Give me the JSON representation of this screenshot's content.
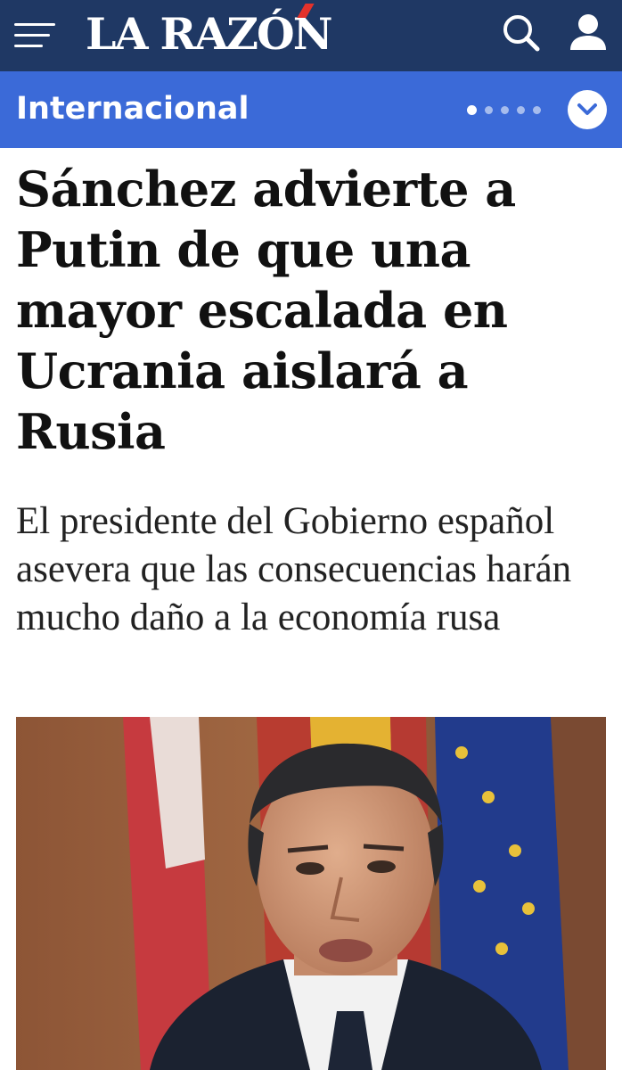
{
  "header": {
    "logo_text": "LA RAZÓN",
    "background_color": "#1f3864",
    "logo_accent_color": "#e3322b",
    "menu_icon": "hamburger-menu-icon",
    "search_icon": "search-icon",
    "user_icon": "user-icon"
  },
  "section_bar": {
    "label": "Internacional",
    "background_color": "#3b6ad8",
    "carousel_dots_total": 5,
    "carousel_active_index": 0,
    "expand_icon": "chevron-down-icon"
  },
  "article": {
    "headline": "Sánchez advierte a Putin de que una mayor escalada en Ucrania aislará a Rusia",
    "subtitle": "El presidente del Gobierno español asevera que las consecuencias harán mucho daño a la economía rusa"
  },
  "photo": {
    "icon": "article-photo"
  }
}
